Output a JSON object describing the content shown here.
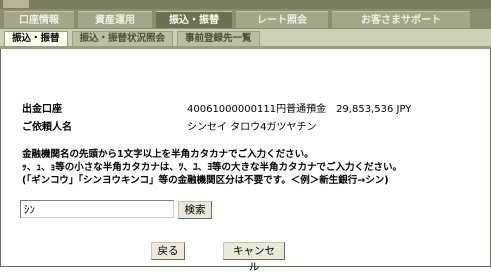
{
  "header": {
    "title": "振込・振替"
  },
  "tabs": [
    {
      "label": "口座情報"
    },
    {
      "label": "資産運用"
    },
    {
      "label": "振込・振替"
    },
    {
      "label": "レート照会"
    },
    {
      "label": "お客さまサポート"
    }
  ],
  "subtabs": [
    {
      "label": "振込・振替"
    },
    {
      "label": "振込・振替状況照会"
    },
    {
      "label": "事前登録先一覧"
    }
  ],
  "details": {
    "source_account_label": "出金口座",
    "source_account_value": "40061000000111円普通預金　29,853,536 JPY",
    "requester_label": "ご依頼人名",
    "requester_value": "シンセイ タロウ4ガツヤチン"
  },
  "instructions": {
    "line1": "金融機関名の先頭から1文字以上を半角カタカナでご入力ください。",
    "line2": "ｯ、ｭ、ｮ等の小さな半角カタカナは、ﾂ、ﾕ、ﾖ等の大きな半角カタカナでご入力ください。",
    "line3": "(「ギンコウ」「シンヨウキンコ」等の金融機関区分は不要です。＜例＞新生銀行→シン)"
  },
  "search": {
    "value": "ｼﾝ",
    "button_label": "検索"
  },
  "actions": {
    "back_label": "戻る",
    "cancel_label": "キャンセル"
  },
  "colors": {
    "accent": "#7c7c62",
    "active_tab": "#6f6f57",
    "subtab_bar": "#cfcfb9"
  }
}
